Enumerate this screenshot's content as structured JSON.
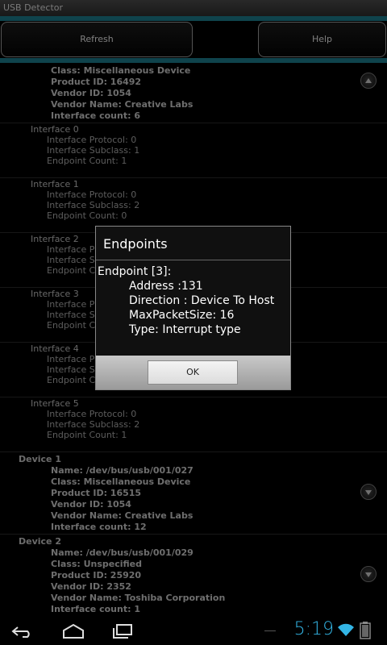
{
  "app": {
    "title": "USB Detector"
  },
  "toolbar": {
    "refresh_label": "Refresh",
    "help_label": "Help"
  },
  "device0": {
    "class": "Class: Miscellaneous Device",
    "product_id": "Product ID: 16492",
    "vendor_id": "Vendor ID:   1054",
    "vendor_name": "Vendor Name:  Creative Labs",
    "interface_count": "Interface count: 6"
  },
  "interfaces": [
    {
      "title": "Interface 0",
      "protocol": "Interface Protocol: 0",
      "subclass": "Interface Subclass: 1",
      "endpoints": "Endpoint Count:     1"
    },
    {
      "title": "Interface 1",
      "protocol": "Interface Protocol: 0",
      "subclass": "Interface Subclass: 2",
      "endpoints": "Endpoint Count:     0"
    },
    {
      "title": "Interface 2",
      "protocol": "Interface Pro",
      "subclass": "Interface Sub",
      "endpoints": "Endpoint Co"
    },
    {
      "title": "Interface 3",
      "protocol": "Interface Proto",
      "subclass": "Interface Subcl",
      "endpoints": "Endpoint Co"
    },
    {
      "title": "Interface 4",
      "protocol": "Interface Pro",
      "subclass": "Interface Sub",
      "endpoints": "Endpoint Co"
    },
    {
      "title": "Interface 5",
      "protocol": "Interface Protocol: 0",
      "subclass": "Interface Subclass: 2",
      "endpoints": "Endpoint Count:     1"
    }
  ],
  "device1": {
    "title": "Device 1",
    "name": "Name: /dev/bus/usb/001/027",
    "class": "Class: Miscellaneous Device",
    "product_id": "Product ID: 16515",
    "vendor_id": "Vendor ID:   1054",
    "vendor_name": "Vendor Name:  Creative Labs",
    "interface_count": "Interface count: 12"
  },
  "device2": {
    "title": "Device 2",
    "name": "Name: /dev/bus/usb/001/029",
    "class": "Class: Unspecified",
    "product_id": "Product ID: 25920",
    "vendor_id": "Vendor ID:   2352",
    "vendor_name": "Vendor Name:  Toshiba Corporation",
    "interface_count": "Interface count: 1"
  },
  "dialog": {
    "title": "Endpoints",
    "endpoint": "Endpoint [3]:",
    "address": "Address :131",
    "direction": "Direction : Device To Host",
    "max_packet": "MaxPacketSize: 16",
    "type": "Type: Interrupt type",
    "ok_label": "OK"
  },
  "status": {
    "time": "5:19",
    "accent": "#33b5e5"
  },
  "icons": [
    "back-icon",
    "home-icon",
    "recent-apps-icon",
    "wifi-icon",
    "battery-icon"
  ]
}
